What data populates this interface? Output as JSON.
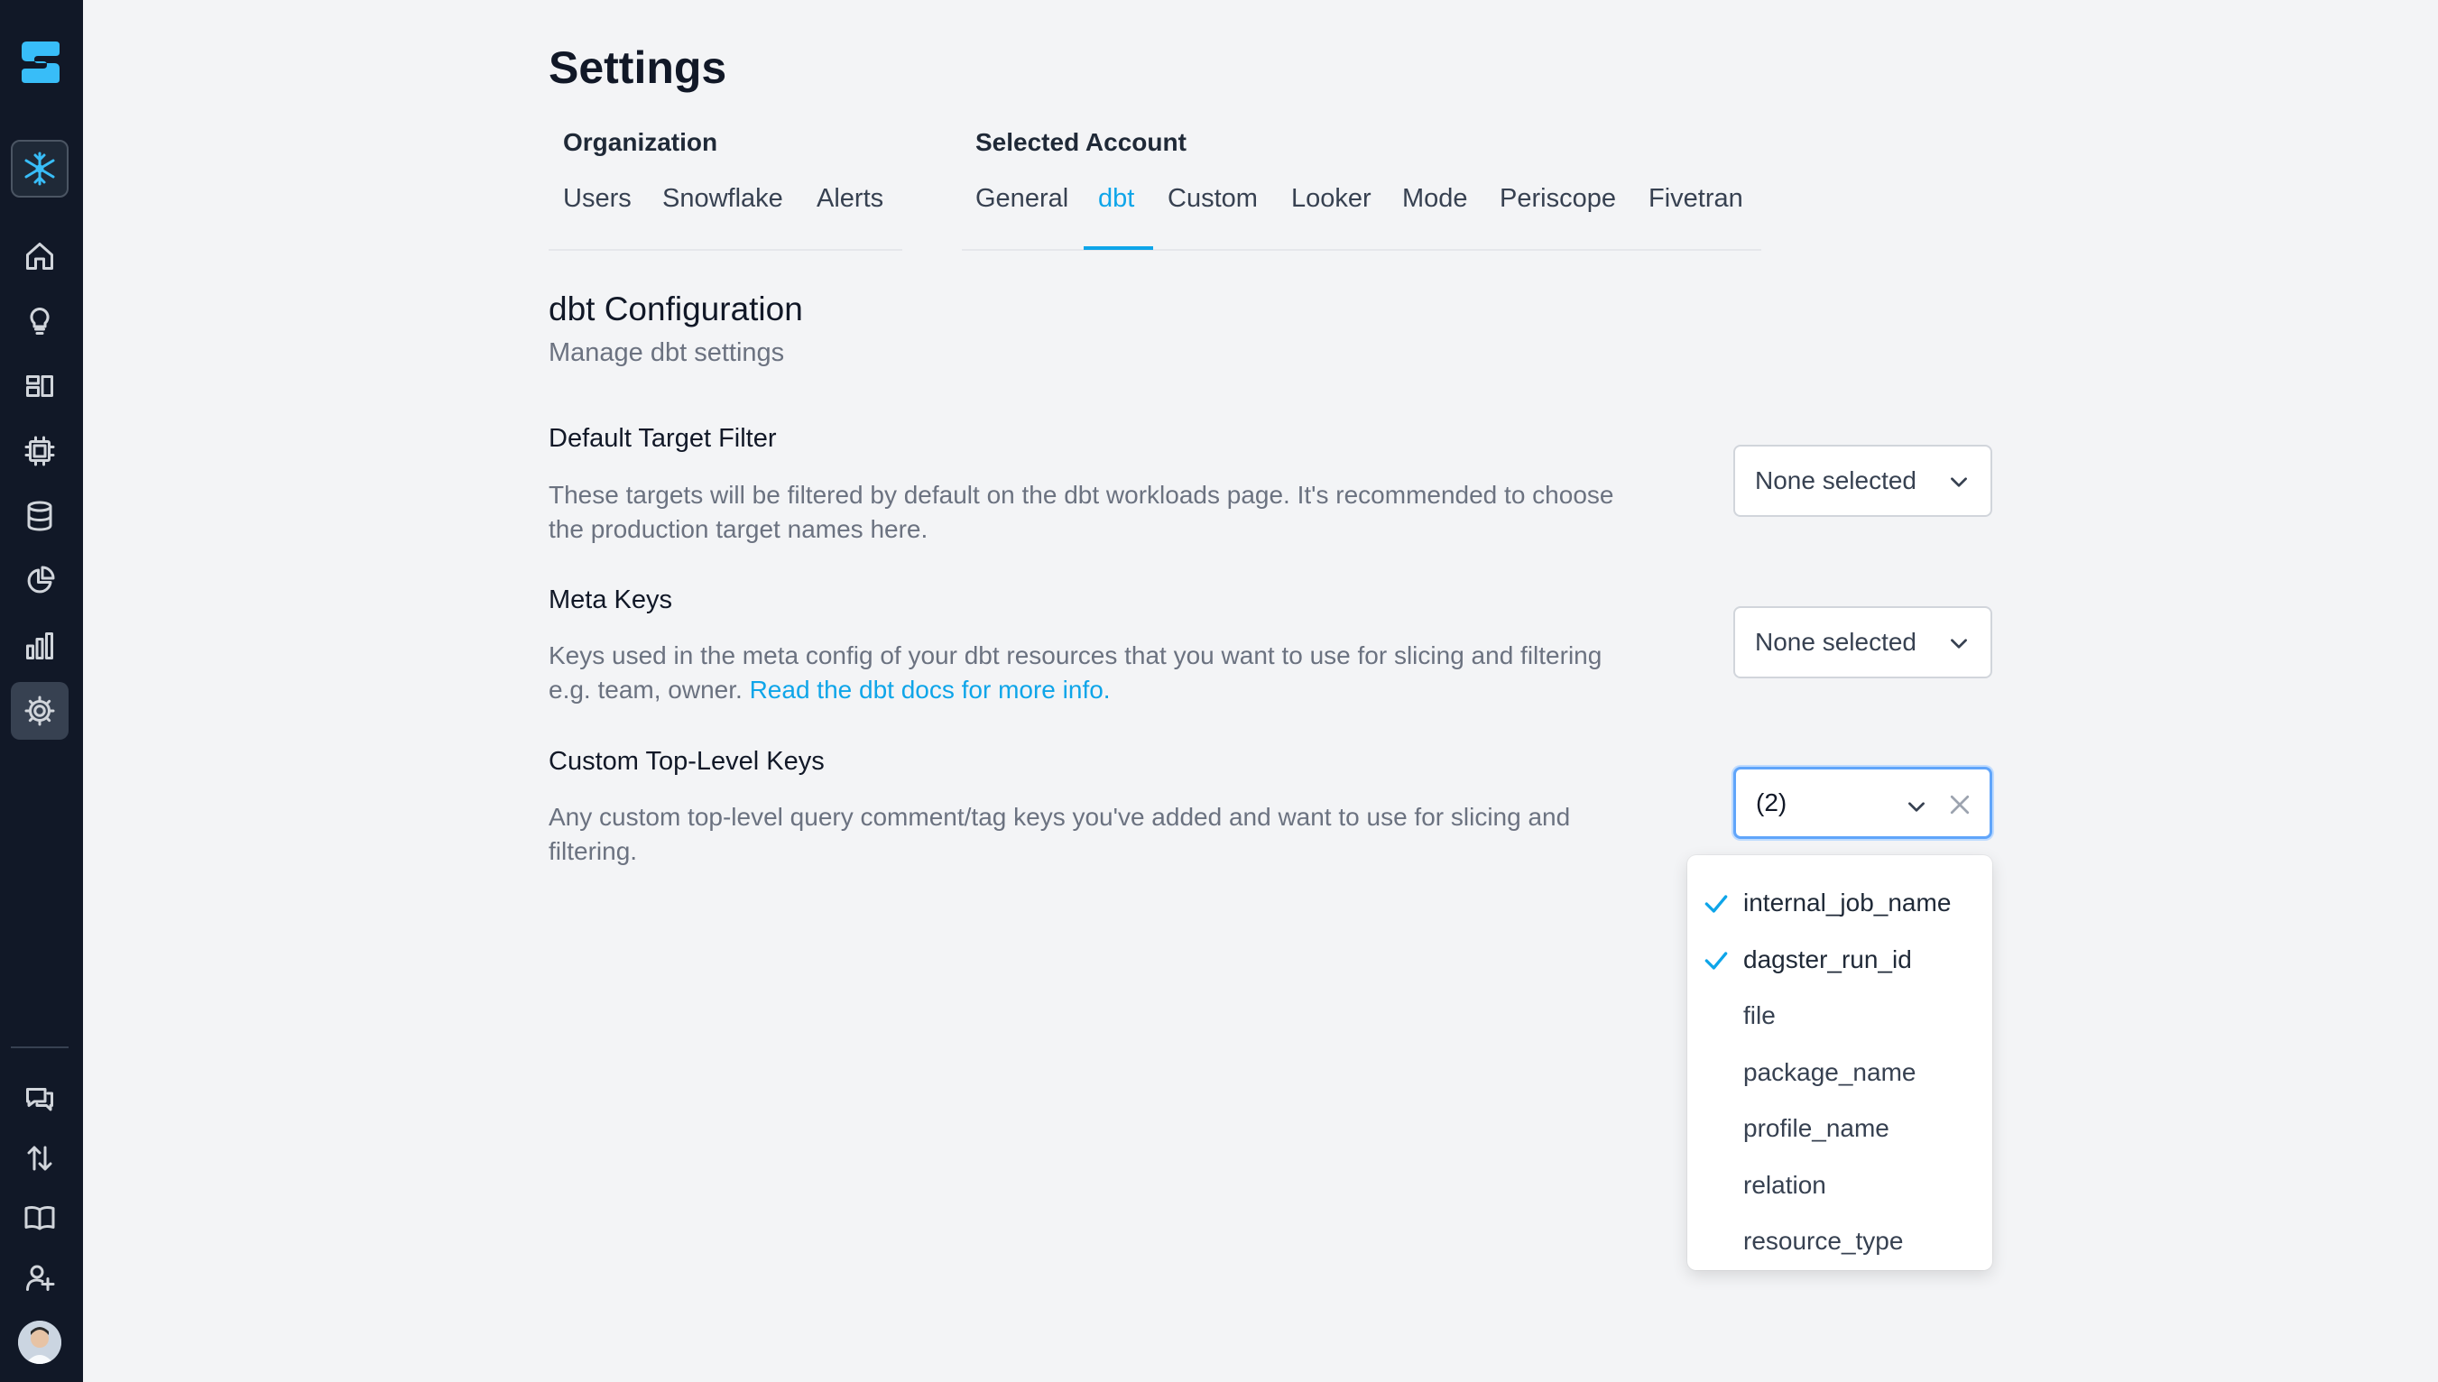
{
  "app": {
    "title": "Settings"
  },
  "sidebar": {
    "icons": [
      "logo-icon",
      "snowflake-icon",
      "home-icon",
      "lightbulb-icon",
      "dashboard-icon",
      "chip-icon",
      "database-icon",
      "pie-chart-icon",
      "bar-chart-icon",
      "gear-icon",
      "chat-icon",
      "sort-arrows-icon",
      "book-icon",
      "add-user-icon"
    ],
    "active": "gear-icon"
  },
  "tabs": {
    "organization": {
      "label": "Organization",
      "items": [
        "Users",
        "Snowflake",
        "Alerts"
      ]
    },
    "selected_account": {
      "label": "Selected Account",
      "items": [
        "General",
        "dbt",
        "Custom",
        "Looker",
        "Mode",
        "Periscope",
        "Fivetran"
      ],
      "active": "dbt"
    }
  },
  "section": {
    "title": "dbt Configuration",
    "subtitle": "Manage dbt settings"
  },
  "fields": {
    "default_target": {
      "label": "Default Target Filter",
      "desc_line1": "These targets will be filtered by default on the dbt workloads page. It's recommended to choose",
      "desc_line2": "the production target names here.",
      "value": "None selected"
    },
    "meta_keys": {
      "label": "Meta Keys",
      "desc_line1": "Keys used in the meta config of your dbt resources that you want to use for slicing and filtering",
      "desc_line2_prefix": "e.g. team, owner. ",
      "desc_link": "Read the dbt docs for more info.",
      "value": "None selected"
    },
    "custom_keys": {
      "label": "Custom Top-Level Keys",
      "desc_line1": "Any custom top-level query comment/tag keys you've added and want to use for slicing and",
      "desc_line2": "filtering.",
      "value": "(2)",
      "options": [
        {
          "label": "internal_job_name",
          "selected": true
        },
        {
          "label": "dagster_run_id",
          "selected": true
        },
        {
          "label": "file",
          "selected": false
        },
        {
          "label": "package_name",
          "selected": false
        },
        {
          "label": "profile_name",
          "selected": false
        },
        {
          "label": "relation",
          "selected": false
        },
        {
          "label": "resource_type",
          "selected": false
        }
      ]
    }
  },
  "colors": {
    "accent": "#0ea5e9",
    "sidebar": "#111827",
    "background": "#f3f4f6"
  }
}
